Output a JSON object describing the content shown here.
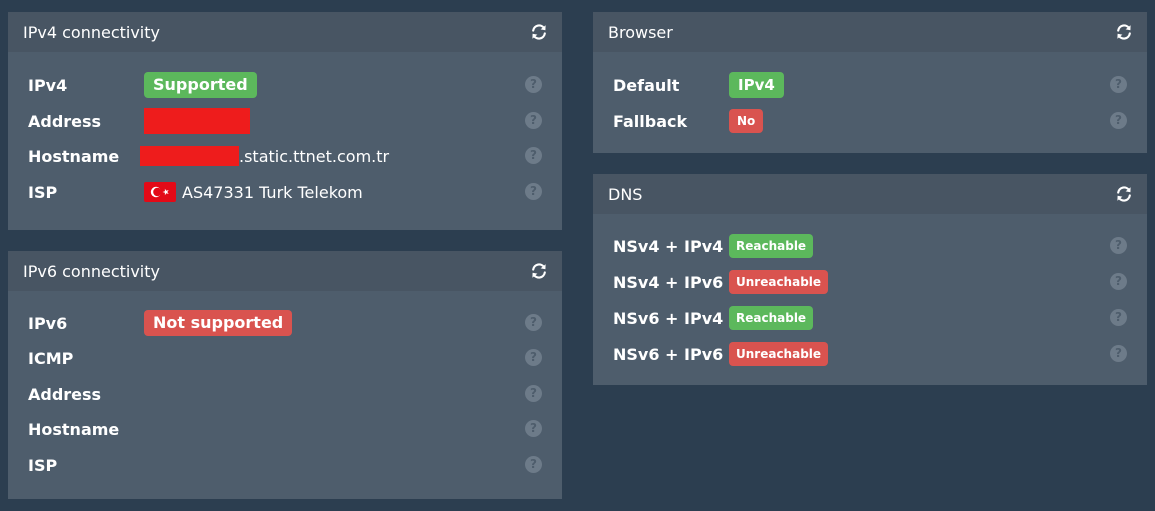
{
  "ipv4_panel": {
    "title": "IPv4 connectivity",
    "rows": [
      {
        "label": "IPv4",
        "status": "Supported"
      },
      {
        "label": "Address"
      },
      {
        "label": "Hostname",
        "suffix": ".static.ttnet.com.tr"
      },
      {
        "label": "ISP",
        "isp": "AS47331 Turk Telekom",
        "flag": "turkey-flag-icon"
      }
    ]
  },
  "ipv6_panel": {
    "title": "IPv6 connectivity",
    "rows": [
      {
        "label": "IPv6",
        "status": "Not supported"
      },
      {
        "label": "ICMP"
      },
      {
        "label": "Address"
      },
      {
        "label": "Hostname"
      },
      {
        "label": "ISP"
      }
    ]
  },
  "browser_panel": {
    "title": "Browser",
    "rows": [
      {
        "label": "Default",
        "status": "IPv4"
      },
      {
        "label": "Fallback",
        "status": "No"
      }
    ]
  },
  "dns_panel": {
    "title": "DNS",
    "rows": [
      {
        "label": "NSv4 + IPv4",
        "status": "Reachable"
      },
      {
        "label": "NSv4 + IPv6",
        "status": "Unreachable"
      },
      {
        "label": "NSv6 + IPv4",
        "status": "Reachable"
      },
      {
        "label": "NSv6 + IPv6",
        "status": "Unreachable"
      }
    ]
  },
  "help_glyph": "?",
  "colors": {
    "background": "#2c3e50",
    "panel": "#4e5d6c",
    "panel_header": "#485563",
    "success": "#5cb85c",
    "danger": "#d9534f",
    "redaction": "#ee1c1c"
  },
  "icons": {
    "refresh": "refresh-icon",
    "help": "help-icon"
  }
}
